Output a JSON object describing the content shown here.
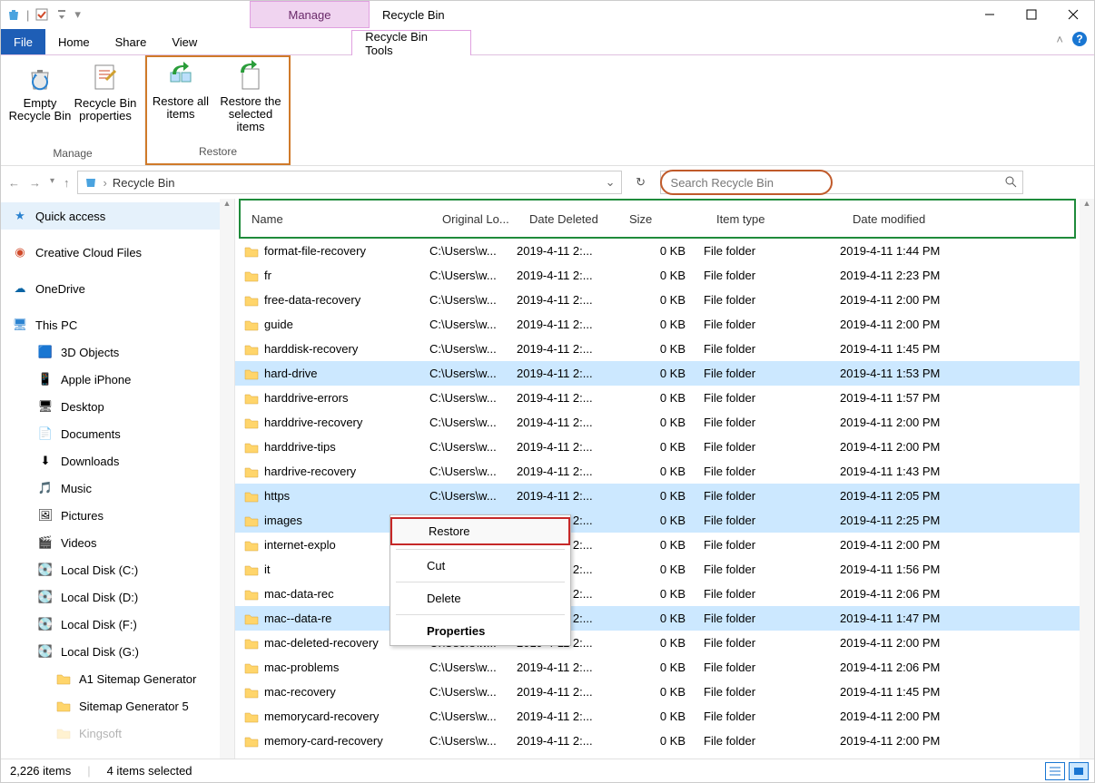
{
  "title": "Recycle Bin",
  "context_tab": "Manage",
  "tabs": {
    "file": "File",
    "home": "Home",
    "share": "Share",
    "view": "View",
    "tools": "Recycle Bin Tools"
  },
  "ribbon": {
    "manage": {
      "empty": "Empty Recycle Bin",
      "props": "Recycle Bin properties",
      "label": "Manage"
    },
    "restore": {
      "all": "Restore all items",
      "selected": "Restore the selected items",
      "label": "Restore"
    }
  },
  "breadcrumb": "Recycle Bin",
  "search_placeholder": "Search Recycle Bin",
  "columns": {
    "name": "Name",
    "orig": "Original Lo...",
    "del": "Date Deleted",
    "size": "Size",
    "type": "Item type",
    "mod": "Date modified"
  },
  "sidebar": {
    "quick": "Quick access",
    "ccf": "Creative Cloud Files",
    "onedrive": "OneDrive",
    "thispc": "This PC",
    "items": [
      "3D Objects",
      "Apple iPhone",
      "Desktop",
      "Documents",
      "Downloads",
      "Music",
      "Pictures",
      "Videos",
      "Local Disk (C:)",
      "Local Disk (D:)",
      "Local Disk (F:)",
      "Local Disk (G:)"
    ],
    "g_children": [
      "A1 Sitemap Generator",
      "Sitemap Generator 5",
      "Kingsoft"
    ]
  },
  "rows": [
    {
      "n": "format-file-recovery",
      "o": "C:\\Users\\w...",
      "d": "2019-4-11 2:...",
      "s": "0 KB",
      "t": "File folder",
      "m": "2019-4-11 1:44 PM",
      "sel": false
    },
    {
      "n": "fr",
      "o": "C:\\Users\\w...",
      "d": "2019-4-11 2:...",
      "s": "0 KB",
      "t": "File folder",
      "m": "2019-4-11 2:23 PM",
      "sel": false
    },
    {
      "n": "free-data-recovery",
      "o": "C:\\Users\\w...",
      "d": "2019-4-11 2:...",
      "s": "0 KB",
      "t": "File folder",
      "m": "2019-4-11 2:00 PM",
      "sel": false
    },
    {
      "n": "guide",
      "o": "C:\\Users\\w...",
      "d": "2019-4-11 2:...",
      "s": "0 KB",
      "t": "File folder",
      "m": "2019-4-11 2:00 PM",
      "sel": false
    },
    {
      "n": "harddisk-recovery",
      "o": "C:\\Users\\w...",
      "d": "2019-4-11 2:...",
      "s": "0 KB",
      "t": "File folder",
      "m": "2019-4-11 1:45 PM",
      "sel": false
    },
    {
      "n": "hard-drive",
      "o": "C:\\Users\\w...",
      "d": "2019-4-11 2:...",
      "s": "0 KB",
      "t": "File folder",
      "m": "2019-4-11 1:53 PM",
      "sel": true
    },
    {
      "n": "harddrive-errors",
      "o": "C:\\Users\\w...",
      "d": "2019-4-11 2:...",
      "s": "0 KB",
      "t": "File folder",
      "m": "2019-4-11 1:57 PM",
      "sel": false
    },
    {
      "n": "harddrive-recovery",
      "o": "C:\\Users\\w...",
      "d": "2019-4-11 2:...",
      "s": "0 KB",
      "t": "File folder",
      "m": "2019-4-11 2:00 PM",
      "sel": false
    },
    {
      "n": "harddrive-tips",
      "o": "C:\\Users\\w...",
      "d": "2019-4-11 2:...",
      "s": "0 KB",
      "t": "File folder",
      "m": "2019-4-11 2:00 PM",
      "sel": false
    },
    {
      "n": "hardrive-recovery",
      "o": "C:\\Users\\w...",
      "d": "2019-4-11 2:...",
      "s": "0 KB",
      "t": "File folder",
      "m": "2019-4-11 1:43 PM",
      "sel": false
    },
    {
      "n": "https",
      "o": "C:\\Users\\w...",
      "d": "2019-4-11 2:...",
      "s": "0 KB",
      "t": "File folder",
      "m": "2019-4-11 2:05 PM",
      "sel": true
    },
    {
      "n": "images",
      "o": "C:\\Users\\w...",
      "d": "2019-4-11 2:...",
      "s": "0 KB",
      "t": "File folder",
      "m": "2019-4-11 2:25 PM",
      "sel": true
    },
    {
      "n": "internet-explo",
      "o": "",
      "d": "2019-4-11 2:...",
      "s": "0 KB",
      "t": "File folder",
      "m": "2019-4-11 2:00 PM",
      "sel": false
    },
    {
      "n": "it",
      "o": "",
      "d": "2019-4-11 2:...",
      "s": "0 KB",
      "t": "File folder",
      "m": "2019-4-11 1:56 PM",
      "sel": false
    },
    {
      "n": "mac-data-rec",
      "o": "",
      "d": "2019-4-11 2:...",
      "s": "0 KB",
      "t": "File folder",
      "m": "2019-4-11 2:06 PM",
      "sel": false
    },
    {
      "n": "mac--data-re",
      "o": "",
      "d": "2019-4-11 2:...",
      "s": "0 KB",
      "t": "File folder",
      "m": "2019-4-11 1:47 PM",
      "sel": true
    },
    {
      "n": "mac-deleted-recovery",
      "o": "C:\\Users\\w...",
      "d": "2019-4-11 2:...",
      "s": "0 KB",
      "t": "File folder",
      "m": "2019-4-11 2:00 PM",
      "sel": false
    },
    {
      "n": "mac-problems",
      "o": "C:\\Users\\w...",
      "d": "2019-4-11 2:...",
      "s": "0 KB",
      "t": "File folder",
      "m": "2019-4-11 2:06 PM",
      "sel": false
    },
    {
      "n": "mac-recovery",
      "o": "C:\\Users\\w...",
      "d": "2019-4-11 2:...",
      "s": "0 KB",
      "t": "File folder",
      "m": "2019-4-11 1:45 PM",
      "sel": false
    },
    {
      "n": "memorycard-recovery",
      "o": "C:\\Users\\w...",
      "d": "2019-4-11 2:...",
      "s": "0 KB",
      "t": "File folder",
      "m": "2019-4-11 2:00 PM",
      "sel": false
    },
    {
      "n": "memory-card-recovery",
      "o": "C:\\Users\\w...",
      "d": "2019-4-11 2:...",
      "s": "0 KB",
      "t": "File folder",
      "m": "2019-4-11 2:00 PM",
      "sel": false
    }
  ],
  "context_menu": {
    "restore": "Restore",
    "cut": "Cut",
    "delete": "Delete",
    "properties": "Properties"
  },
  "status": {
    "count": "2,226 items",
    "selected": "4 items selected"
  }
}
